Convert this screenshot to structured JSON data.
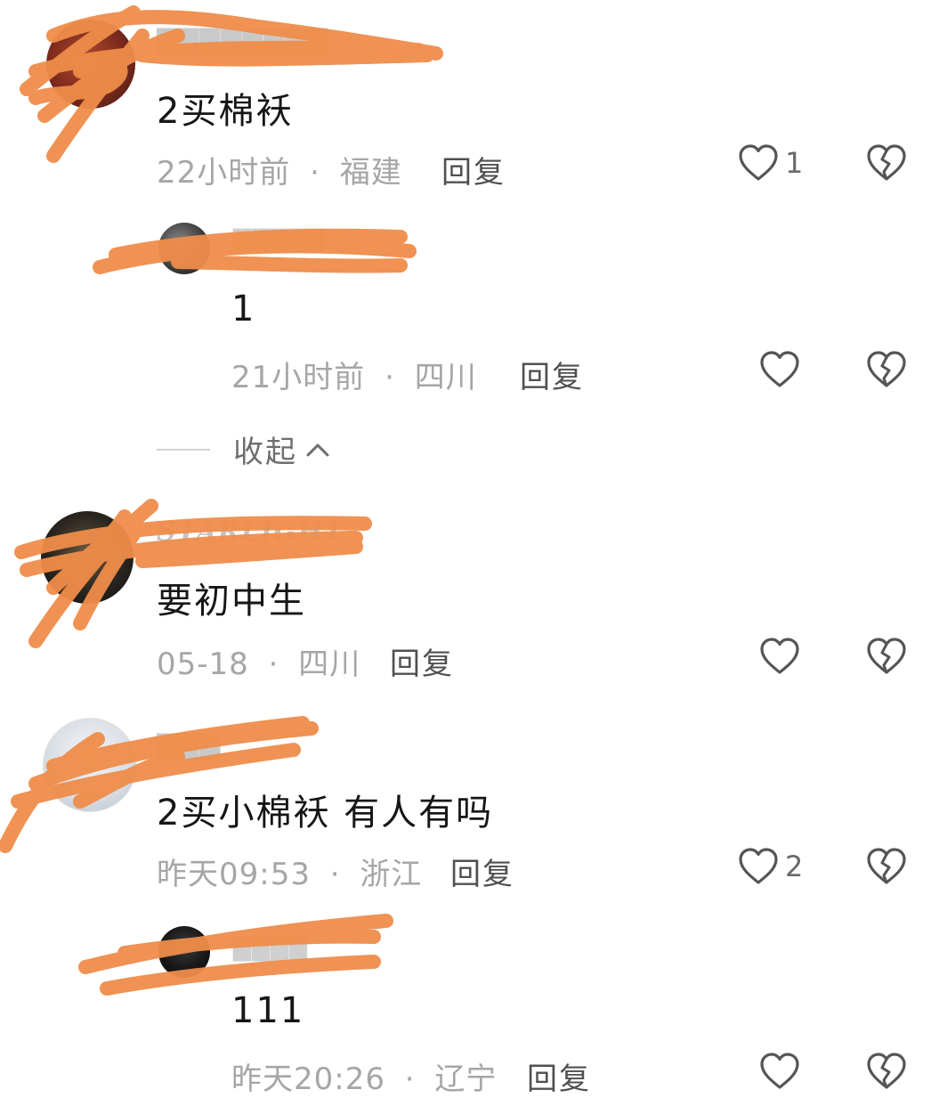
{
  "comments": [
    {
      "content": "2买棉袄",
      "time": "22小时前",
      "location": "福建",
      "reply_label": "回复",
      "likes": "1",
      "replies": [
        {
          "content": "1",
          "time": "21小时前",
          "location": "四川",
          "reply_label": "回复",
          "likes": ""
        }
      ],
      "collapse_label": "收起"
    },
    {
      "username_partial": "STARLIGHT",
      "content": "要初中生",
      "time": "05-18",
      "location": "四川",
      "reply_label": "回复",
      "likes": ""
    },
    {
      "content": "2买小棉袄 有人有吗",
      "time": "昨天09:53",
      "location": "浙江",
      "reply_label": "回复",
      "likes": "2",
      "replies": [
        {
          "content": "111",
          "time": "昨天20:26",
          "location": "辽宁",
          "reply_label": "回复",
          "likes": ""
        }
      ]
    }
  ],
  "separator": "·",
  "icons": {
    "like": "heart-outline-icon",
    "dislike": "broken-heart-icon",
    "collapse": "chevron-up-icon"
  },
  "colors": {
    "redaction": "#ef8d4a",
    "text_primary": "#161616",
    "text_meta": "#a6a6a6",
    "reply": "#505050",
    "icon": "#555555"
  }
}
